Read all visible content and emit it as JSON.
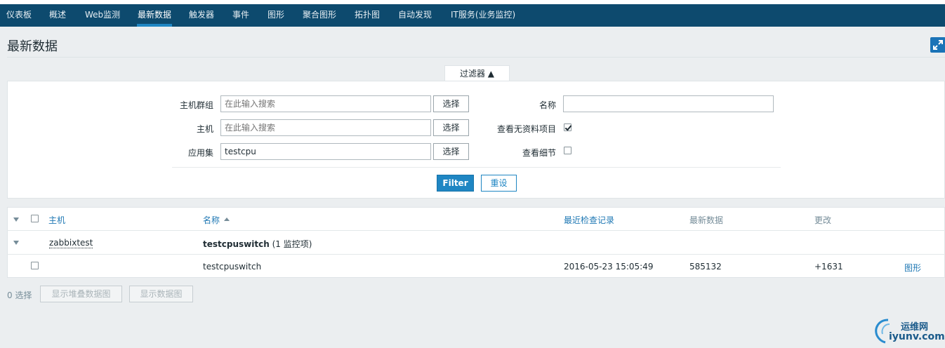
{
  "nav": {
    "items": [
      {
        "label": "仪表板"
      },
      {
        "label": "概述"
      },
      {
        "label": "Web监测"
      },
      {
        "label": "最新数据"
      },
      {
        "label": "触发器"
      },
      {
        "label": "事件"
      },
      {
        "label": "图形"
      },
      {
        "label": "聚合图形"
      },
      {
        "label": "拓扑图"
      },
      {
        "label": "自动发现"
      },
      {
        "label": "IT服务(业务监控)"
      }
    ],
    "active": "最新数据"
  },
  "page": {
    "title": "最新数据"
  },
  "filter": {
    "tab_label": "过滤器 ▲",
    "host_group_label": "主机群组",
    "host_group_placeholder": "在此输入搜索",
    "host_label": "主机",
    "host_placeholder": "在此输入搜索",
    "application_label": "应用集",
    "application_value": "testcpu",
    "select_label": "选择",
    "name_label": "名称",
    "name_value": "",
    "show_without_data_label": "查看无资料项目",
    "show_without_data_checked": true,
    "show_details_label": "查看细节",
    "show_details_checked": false,
    "submit_label": "Filter",
    "reset_label": "重设"
  },
  "table": {
    "headers": {
      "host": "主机",
      "name": "名称",
      "last_check": "最近检查记录",
      "last_value": "最新数据",
      "change": "更改"
    },
    "groups": [
      {
        "host": "zabbixtest",
        "application": "testcpuswitch",
        "item_count": "(1 监控项)",
        "items": [
          {
            "name": "testcpuswitch",
            "last_check": "2016-05-23 15:05:49",
            "last_value": "585132",
            "change": "+1631",
            "graph_link": "图形"
          }
        ]
      }
    ]
  },
  "footer": {
    "selected_count": "0 选择",
    "stacked_graph_label": "显示堆叠数据图",
    "graph_label": "显示数据图"
  },
  "watermark": {
    "line1": "运维网",
    "line2": "iyunv.com"
  },
  "colors": {
    "nav_bg": "#0d4a6e",
    "accent": "#1f86c3",
    "page_bg": "#ebeef0"
  }
}
